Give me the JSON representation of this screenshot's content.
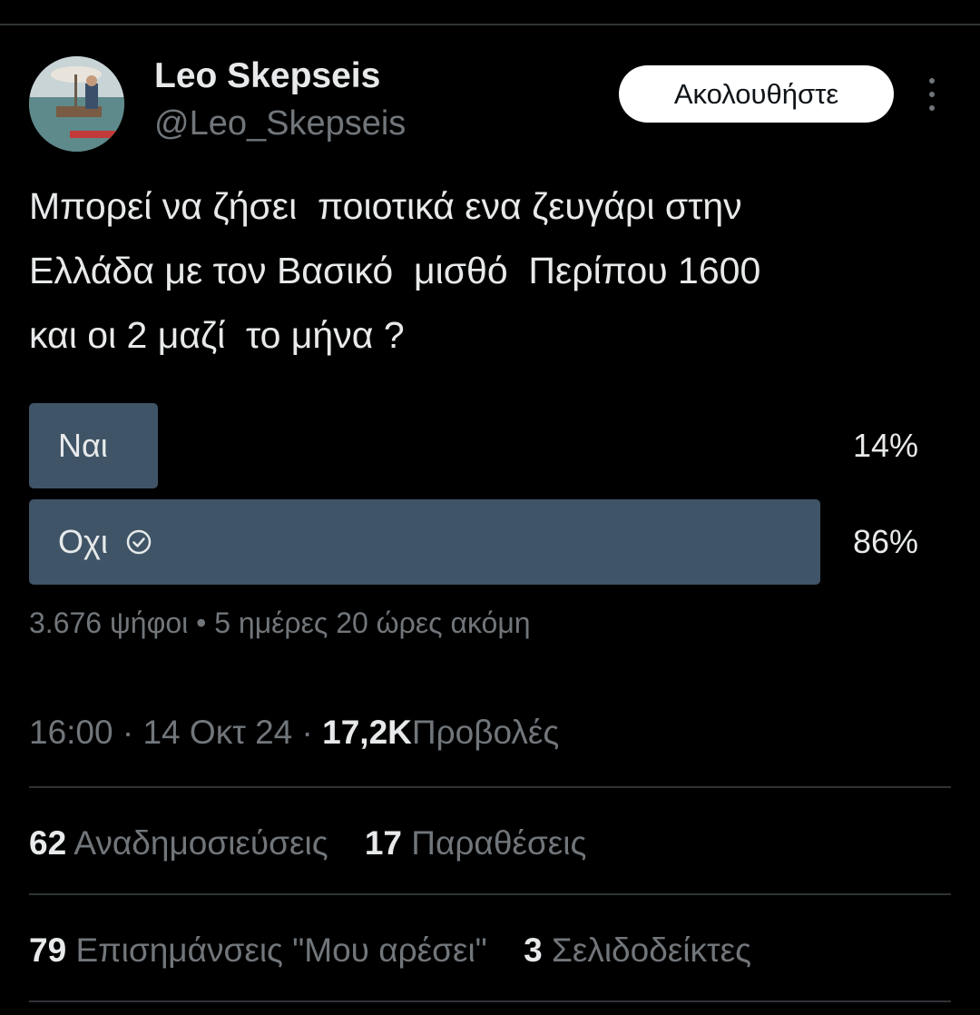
{
  "colors": {
    "background": "#000000",
    "text_primary": "#e7e9ea",
    "text_secondary": "#71767b",
    "poll_bar": "#3f5466",
    "divider": "#2f3336",
    "follow_button_bg": "#ffffff"
  },
  "author": {
    "name": "Leo Skepseis",
    "handle": "@Leo_Skepseis",
    "avatar_icon": "profile-photo"
  },
  "follow_button": {
    "label": "Ακολουθήστε"
  },
  "more_menu_icon": "more-vertical-icon",
  "tweet": {
    "text": "Μπορεί να ζήσει  ποιοτικά ενα ζευγάρι στην\nΕλλάδα με τον Βασικό  μισθό  Περίπου 1600\nκαι οι 2 μαζί  το μήνα ?"
  },
  "poll": {
    "options": [
      {
        "label": "Ναι",
        "percent_label": "14%",
        "percent": 14,
        "selected": false
      },
      {
        "label": "Οχι",
        "percent_label": "86%",
        "percent": 86,
        "selected": true,
        "selected_icon": "check-circle-icon"
      }
    ],
    "votes": "3.676 ψήφοι",
    "separator": "•",
    "time_left": "5 ημέρες 20 ώρες ακόμη"
  },
  "meta": {
    "time": "16:00",
    "dot": "·",
    "date": "14 Οκτ 24",
    "views_count": "17,2K",
    "views_label": "Προβολές"
  },
  "stats": {
    "reposts_count": "62",
    "reposts_label": "Αναδημοσιεύσεις",
    "quotes_count": "17",
    "quotes_label": "Παραθέσεις",
    "likes_count": "79",
    "likes_label": "Επισημάνσεις \"Μου αρέσει\"",
    "bookmarks_count": "3",
    "bookmarks_label": "Σελιδοδείκτες"
  }
}
